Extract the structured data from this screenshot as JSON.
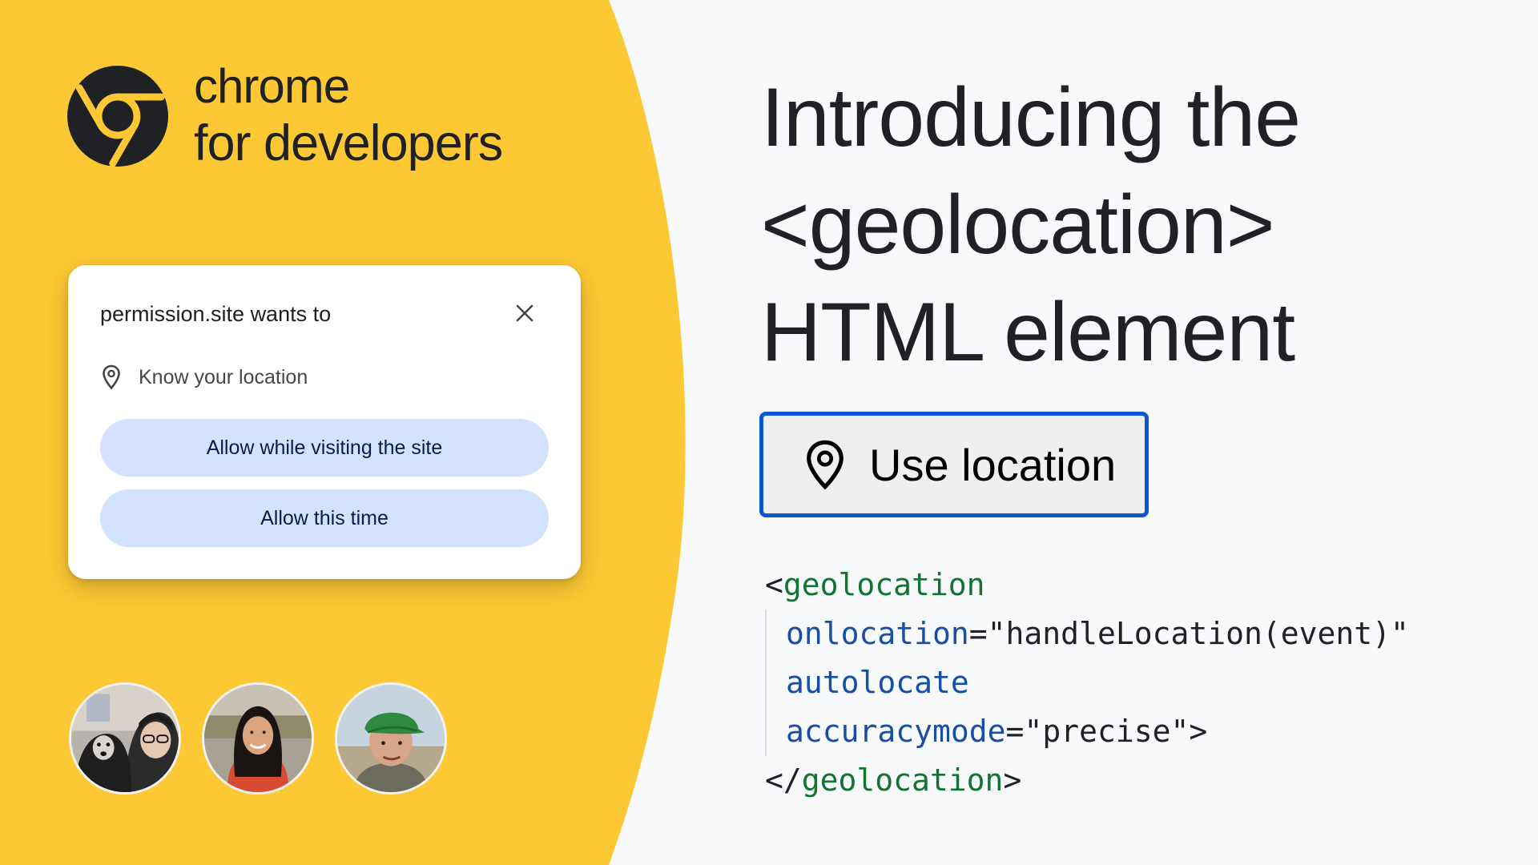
{
  "brand": {
    "line1": "chrome",
    "line2": "for developers",
    "logo_icon": "chrome-logo-icon"
  },
  "permission_prompt": {
    "title": "permission.site wants to",
    "close_icon": "close-icon",
    "request_icon": "location-pin-icon",
    "request_label": "Know your location",
    "allow_visiting_label": "Allow while visiting the site",
    "allow_once_label": "Allow this time"
  },
  "heading": {
    "line1": "Introducing the",
    "line2": "<geolocation>",
    "line3": "HTML element"
  },
  "use_location_button": {
    "icon": "location-pin-icon",
    "label": "Use location"
  },
  "code": {
    "line1_open": "<",
    "line1_tag": "geolocation",
    "line2_attr": "onlocation",
    "line2_eq": "=",
    "line2_value": "\"handleLocation(event)\"",
    "line3_attr": "autolocate",
    "line4_attr": "accuracymode",
    "line4_eq": "=",
    "line4_value": "\"precise\"",
    "line4_close": ">",
    "line5_open": "</",
    "line5_tag": "geolocation",
    "line5_close": ">"
  },
  "colors": {
    "yellow": "#fcc934",
    "accent_blue": "#0b57d0",
    "button_blue": "#d3e3fd",
    "tag_green": "#137333",
    "attr_blue": "#174ea6",
    "text_dark": "#202124"
  },
  "avatars": [
    "avatar-person-with-dog",
    "avatar-person-smiling",
    "avatar-person-green-cap"
  ]
}
